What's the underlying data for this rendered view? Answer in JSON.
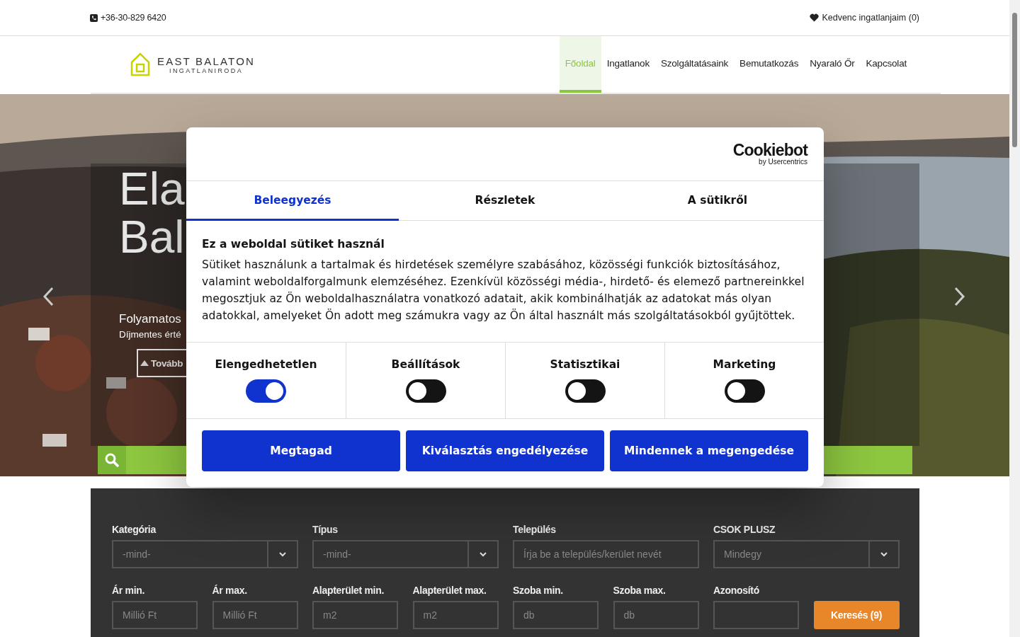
{
  "top_bar": {
    "phone": "+36-30-829 6420",
    "favorites": "Kedvenc ingatlanjaim (0)"
  },
  "header": {
    "logo": {
      "name": "EAST BALATON",
      "subtitle": "INGATLANIRODA"
    },
    "nav": [
      {
        "label": "Főoldal",
        "selected": true
      },
      {
        "label": "Ingatlanok",
        "selected": false
      },
      {
        "label": "Szolgáltatásaink",
        "selected": false
      },
      {
        "label": "Bemutatkozás",
        "selected": false
      },
      {
        "label": "Nyaraló Őr",
        "selected": false
      },
      {
        "label": "Kapcsolat",
        "selected": false
      }
    ]
  },
  "hero": {
    "title_lines": [
      "Ela",
      "Bal"
    ],
    "subtitle": "Folyamatos",
    "text": "Díjmentes érté",
    "button": "Tovább"
  },
  "cookie_dialog": {
    "brand": "Cookiebot",
    "brand_sub": "by Usercentrics",
    "tabs": [
      {
        "label": "Beleegyezés",
        "selected": true
      },
      {
        "label": "Részletek",
        "selected": false
      },
      {
        "label": "A sütikről",
        "selected": false
      }
    ],
    "heading": "Ez a weboldal sütiket használ",
    "body": "Sütiket használunk a tartalmak és hirdetések személyre szabásához, közösségi funkciók biztosításához, valamint weboldalforgalmunk elemzéséhez. Ezenkívül közösségi média-, hirdető- és elemező partnereinkkel megosztjuk az Ön weboldalhasználatra vonatkozó adatait, akik kombinálhatják az adatokat más olyan adatokkal, amelyeket Ön adott meg számukra vagy az Ön által használt más szolgáltatásokból gyűjtöttek.",
    "toggles": [
      {
        "label": "Elengedhetetlen",
        "on": true
      },
      {
        "label": "Beállítások",
        "on": false
      },
      {
        "label": "Statisztikai",
        "on": false
      },
      {
        "label": "Marketing",
        "on": false
      }
    ],
    "buttons": [
      "Megtagad",
      "Kiválasztás engedélyezése",
      "Mindennek a megengedése"
    ]
  },
  "search_form": {
    "fields": [
      {
        "label": "Kategória",
        "kind": "select",
        "value": "-mind-"
      },
      {
        "label": "Típus",
        "kind": "select",
        "value": "-mind-"
      },
      {
        "label": "Település",
        "kind": "input",
        "placeholder": "Írja be a település/kerület nevét"
      },
      {
        "label": "CSOK PLUSZ",
        "kind": "select",
        "value": "Mindegy"
      },
      {
        "label": "Ár min.",
        "kind": "input",
        "placeholder": "Millió Ft"
      },
      {
        "label": "Ár max.",
        "kind": "input",
        "placeholder": "Millió Ft"
      },
      {
        "label": "Alapterület min.",
        "kind": "input",
        "placeholder": "m2"
      },
      {
        "label": "Alapterület max.",
        "kind": "input",
        "placeholder": "m2"
      },
      {
        "label": "Szoba min.",
        "kind": "input",
        "placeholder": "db"
      },
      {
        "label": "Szoba max.",
        "kind": "input",
        "placeholder": "db"
      },
      {
        "label": "Azonosító",
        "kind": "input"
      }
    ],
    "button": "Keresés (9)"
  }
}
